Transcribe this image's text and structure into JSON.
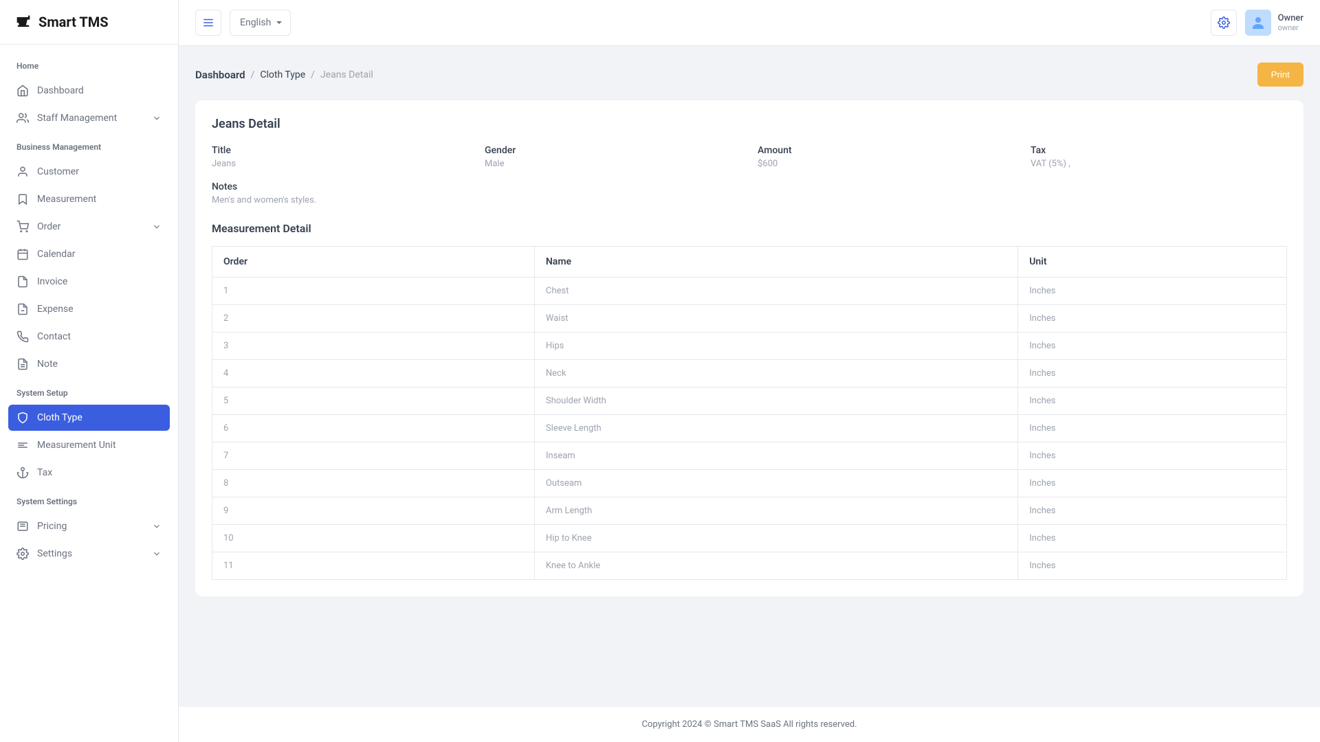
{
  "app": {
    "name": "Smart TMS"
  },
  "sidebar": {
    "sections": [
      {
        "label": "Home",
        "items": [
          {
            "label": "Dashboard",
            "icon": "home",
            "chevron": false,
            "active": false
          },
          {
            "label": "Staff Management",
            "icon": "users",
            "chevron": true,
            "active": false
          }
        ]
      },
      {
        "label": "Business Management",
        "items": [
          {
            "label": "Customer",
            "icon": "user",
            "chevron": false,
            "active": false
          },
          {
            "label": "Measurement",
            "icon": "bookmark",
            "chevron": false,
            "active": false
          },
          {
            "label": "Order",
            "icon": "cart",
            "chevron": true,
            "active": false
          },
          {
            "label": "Calendar",
            "icon": "calendar",
            "chevron": false,
            "active": false
          },
          {
            "label": "Invoice",
            "icon": "file",
            "chevron": false,
            "active": false
          },
          {
            "label": "Expense",
            "icon": "file2",
            "chevron": false,
            "active": false
          },
          {
            "label": "Contact",
            "icon": "phone",
            "chevron": false,
            "active": false
          },
          {
            "label": "Note",
            "icon": "file-text",
            "chevron": false,
            "active": false
          }
        ]
      },
      {
        "label": "System Setup",
        "items": [
          {
            "label": "Cloth Type",
            "icon": "shield",
            "chevron": false,
            "active": true
          },
          {
            "label": "Measurement Unit",
            "icon": "ruler",
            "chevron": false,
            "active": false
          },
          {
            "label": "Tax",
            "icon": "anchor",
            "chevron": false,
            "active": false
          }
        ]
      },
      {
        "label": "System Settings",
        "items": [
          {
            "label": "Pricing",
            "icon": "tag",
            "chevron": true,
            "active": false
          },
          {
            "label": "Settings",
            "icon": "gear",
            "chevron": true,
            "active": false
          }
        ]
      }
    ]
  },
  "topbar": {
    "language": "English",
    "user_name": "Owner",
    "user_role": "owner"
  },
  "breadcrumb": {
    "items": [
      {
        "label": "Dashboard",
        "strong": true
      },
      {
        "label": "Cloth Type",
        "strong": false
      },
      {
        "label": "Jeans Detail",
        "muted": true
      }
    ],
    "print_label": "Print"
  },
  "detail": {
    "title": "Jeans Detail",
    "fields": {
      "title_label": "Title",
      "title_value": "Jeans",
      "gender_label": "Gender",
      "gender_value": "Male",
      "amount_label": "Amount",
      "amount_value": "$600",
      "tax_label": "Tax",
      "tax_value": "VAT (5%) ,",
      "notes_label": "Notes",
      "notes_value": "Men's and women's styles."
    },
    "measurement_title": "Measurement Detail",
    "table": {
      "headers": [
        "Order",
        "Name",
        "Unit"
      ],
      "rows": [
        {
          "order": "1",
          "name": "Chest",
          "unit": "Inches"
        },
        {
          "order": "2",
          "name": "Waist",
          "unit": "Inches"
        },
        {
          "order": "3",
          "name": "Hips",
          "unit": "Inches"
        },
        {
          "order": "4",
          "name": "Neck",
          "unit": "Inches"
        },
        {
          "order": "5",
          "name": "Shoulder Width",
          "unit": "Inches"
        },
        {
          "order": "6",
          "name": "Sleeve Length",
          "unit": "Inches"
        },
        {
          "order": "7",
          "name": "Inseam",
          "unit": "Inches"
        },
        {
          "order": "8",
          "name": "Outseam",
          "unit": "Inches"
        },
        {
          "order": "9",
          "name": "Arm Length",
          "unit": "Inches"
        },
        {
          "order": "10",
          "name": "Hip to Knee",
          "unit": "Inches"
        },
        {
          "order": "11",
          "name": "Knee to Ankle",
          "unit": "Inches"
        }
      ]
    }
  },
  "footer": {
    "text": "Copyright 2024 © Smart TMS SaaS All rights reserved."
  }
}
